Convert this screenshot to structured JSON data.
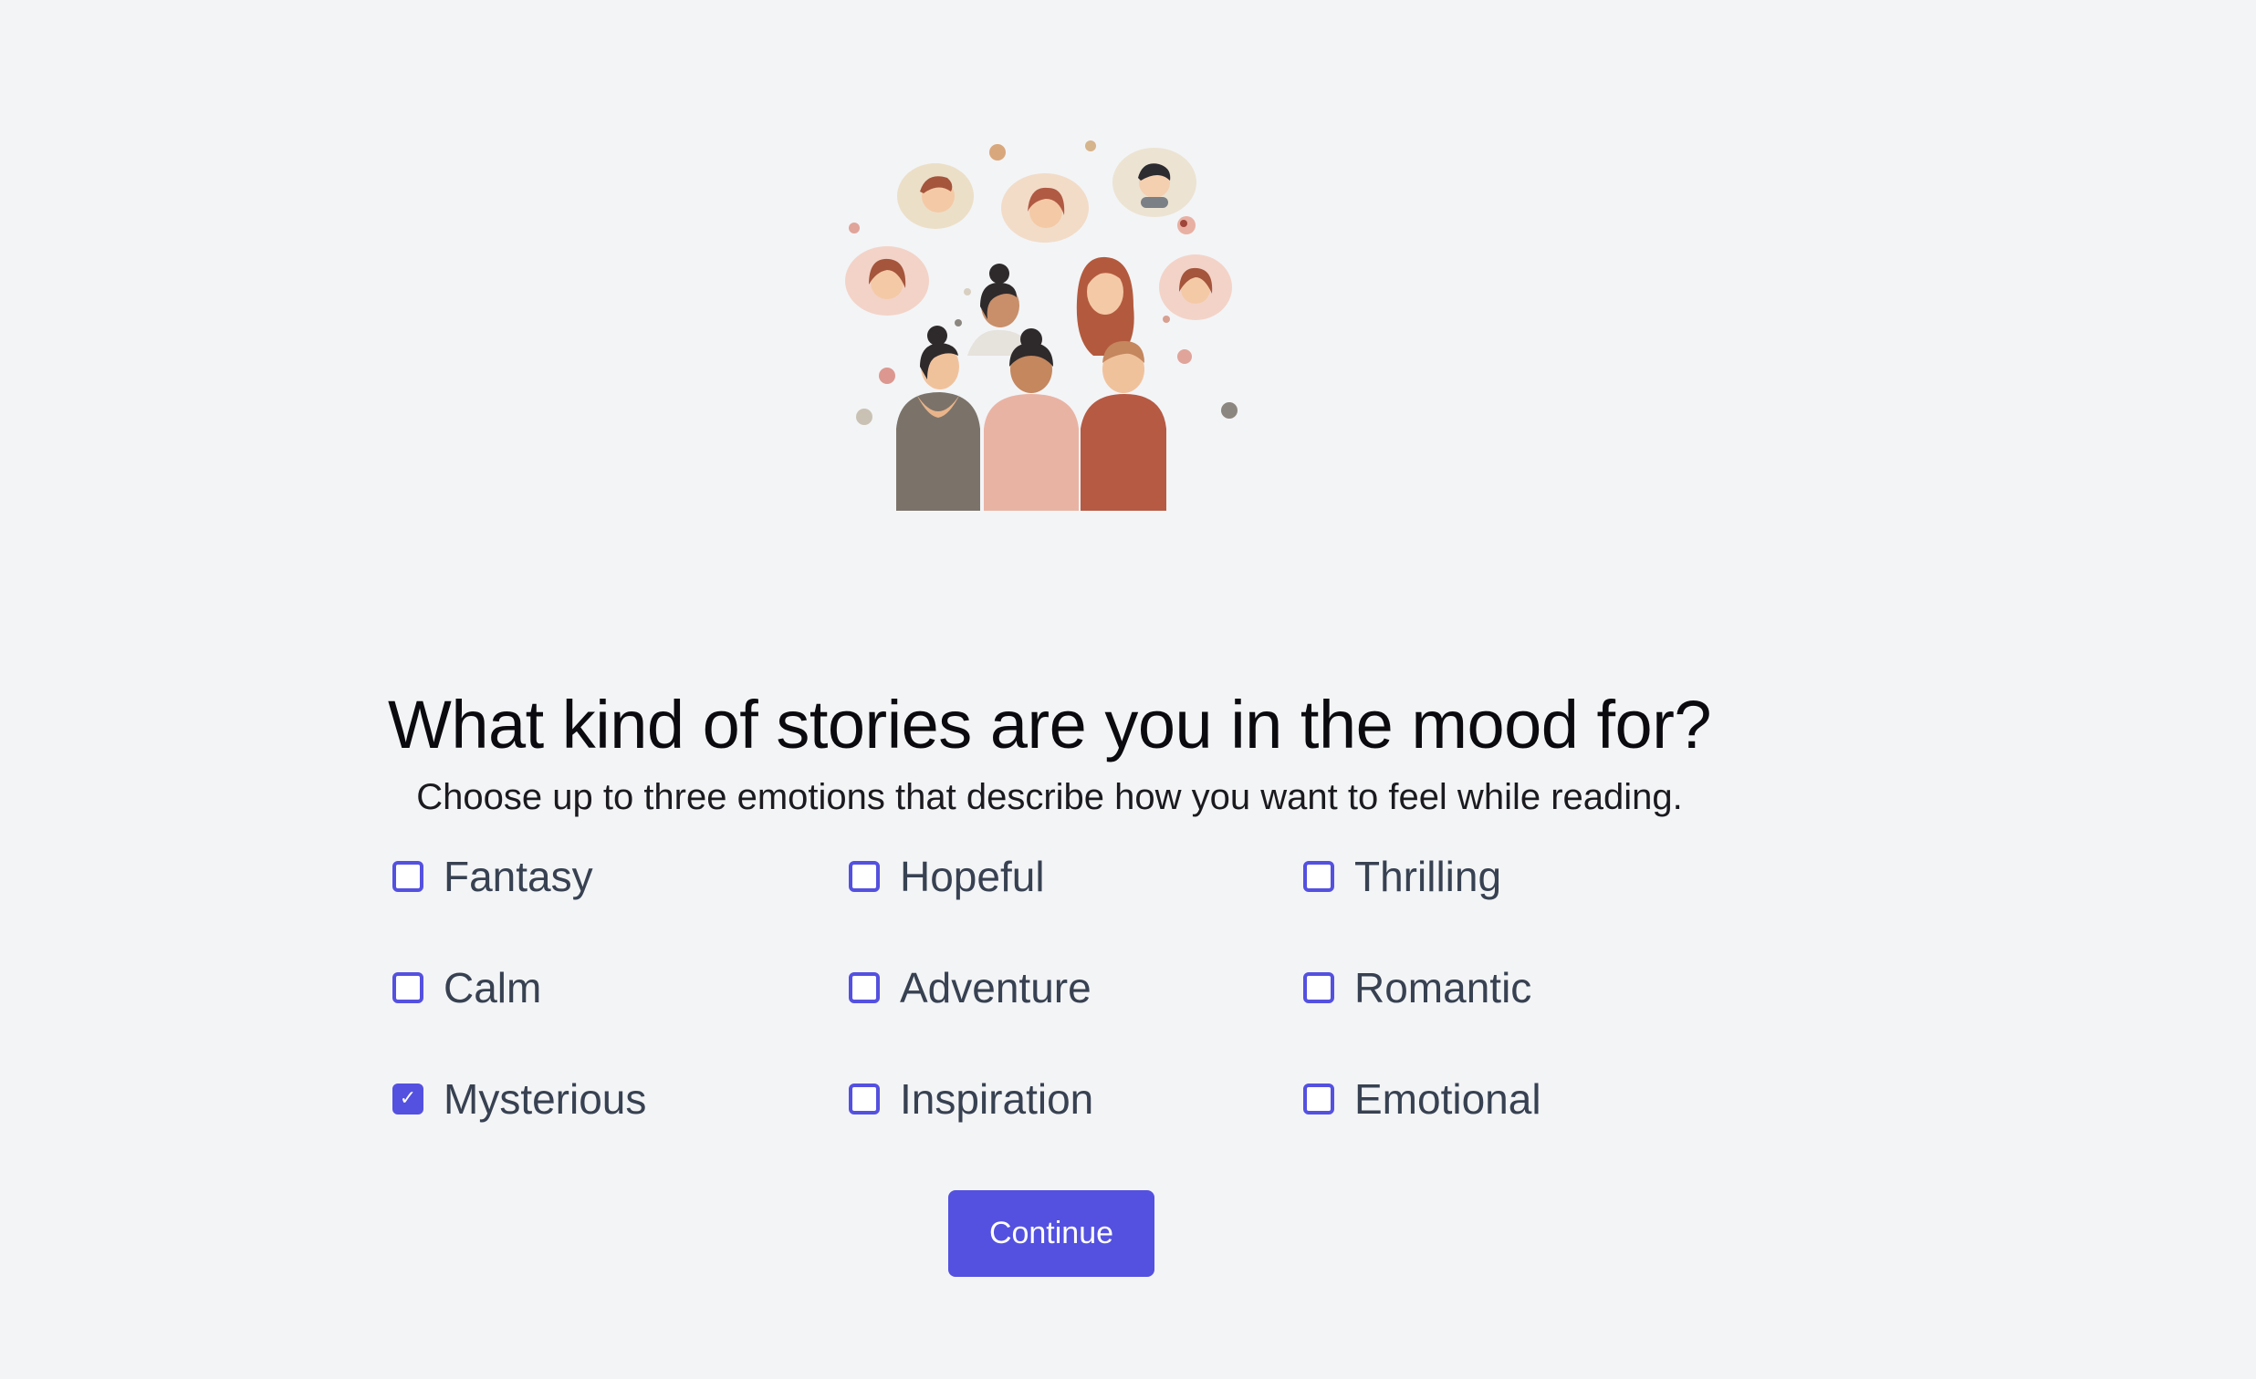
{
  "illustration": {
    "icon": "people-thinking-illustration"
  },
  "heading": {
    "title": "What kind of stories are you in the mood for?",
    "subtitle": "Choose up to three emotions that describe how you want to feel while reading."
  },
  "options": [
    {
      "label": "Fantasy",
      "checked": false
    },
    {
      "label": "Hopeful",
      "checked": false
    },
    {
      "label": "Thrilling",
      "checked": false
    },
    {
      "label": "Calm",
      "checked": false
    },
    {
      "label": "Adventure",
      "checked": false
    },
    {
      "label": "Romantic",
      "checked": false
    },
    {
      "label": "Mysterious",
      "checked": true
    },
    {
      "label": "Inspiration",
      "checked": false
    },
    {
      "label": "Emotional",
      "checked": false
    }
  ],
  "actions": {
    "continue_label": "Continue"
  },
  "colors": {
    "accent": "#5451e0",
    "background": "#f3f4f6",
    "option_text": "#374151"
  }
}
